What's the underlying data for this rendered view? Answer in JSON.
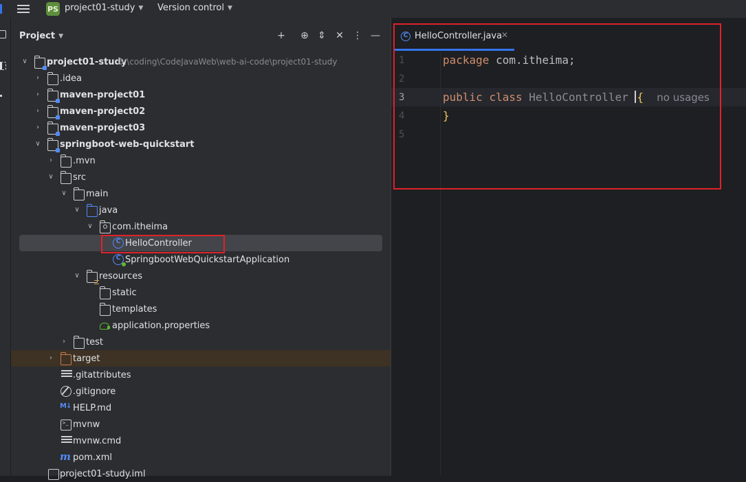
{
  "topbar": {
    "badge": "PS",
    "project_name": "project01-study",
    "vcs_label": "Version control"
  },
  "project_panel": {
    "title": "Project",
    "tree": [
      {
        "label": "project01-study",
        "path": "D:\\coding\\CodeJavaWeb\\web-ai-code\\project01-study",
        "icon": "module-folder-icon",
        "expanded": true
      },
      {
        "label": ".idea",
        "icon": "folder-icon",
        "expanded": false
      },
      {
        "label": "maven-project01",
        "icon": "module-folder-icon",
        "expanded": false
      },
      {
        "label": "maven-project02",
        "icon": "module-folder-icon",
        "expanded": false
      },
      {
        "label": "maven-project03",
        "icon": "module-folder-icon",
        "expanded": false
      },
      {
        "label": "springboot-web-quickstart",
        "icon": "module-folder-icon",
        "expanded": true
      },
      {
        "label": ".mvn",
        "icon": "folder-icon",
        "expanded": false
      },
      {
        "label": "src",
        "icon": "folder-icon",
        "expanded": true
      },
      {
        "label": "main",
        "icon": "folder-icon",
        "expanded": true
      },
      {
        "label": "java",
        "icon": "source-folder-icon",
        "expanded": true
      },
      {
        "label": "com.itheima",
        "icon": "package-icon",
        "expanded": true
      },
      {
        "label": "HelloController",
        "icon": "class-icon",
        "selected": true
      },
      {
        "label": "SpringbootWebQuickstartApplication",
        "icon": "spring-app-class-icon"
      },
      {
        "label": "resources",
        "icon": "resources-folder-icon",
        "expanded": true
      },
      {
        "label": "static",
        "icon": "folder-icon"
      },
      {
        "label": "templates",
        "icon": "folder-icon"
      },
      {
        "label": "application.properties",
        "icon": "spring-properties-icon"
      },
      {
        "label": "test",
        "icon": "folder-icon",
        "expanded": false
      },
      {
        "label": "target",
        "icon": "excluded-folder-icon",
        "expanded": false
      },
      {
        "label": ".gitattributes",
        "icon": "text-file-icon"
      },
      {
        "label": ".gitignore",
        "icon": "gitignore-icon"
      },
      {
        "label": "HELP.md",
        "icon": "markdown-icon"
      },
      {
        "label": "mvnw",
        "icon": "shell-script-icon"
      },
      {
        "label": "mvnw.cmd",
        "icon": "text-file-icon"
      },
      {
        "label": "pom.xml",
        "icon": "maven-icon"
      },
      {
        "label": "project01-study.iml",
        "icon": "iml-file-icon"
      }
    ]
  },
  "editor": {
    "tab_label": "HelloController.java",
    "line_numbers": [
      "1",
      "2",
      "3",
      "4",
      "5"
    ],
    "code": {
      "l1_kw": "package",
      "l1_rest": " com.itheima;",
      "l3_kw1": "public",
      "l3_kw2": "class",
      "l3_name": "HelloController",
      "l3_brace": "{",
      "l3_hint": "no usages",
      "l4_brace": "}"
    }
  },
  "colors": {
    "accent": "#3574f0",
    "annotation_red": "#e0222a",
    "keyword": "#cf8e6d",
    "brace": "#f0c75a"
  }
}
